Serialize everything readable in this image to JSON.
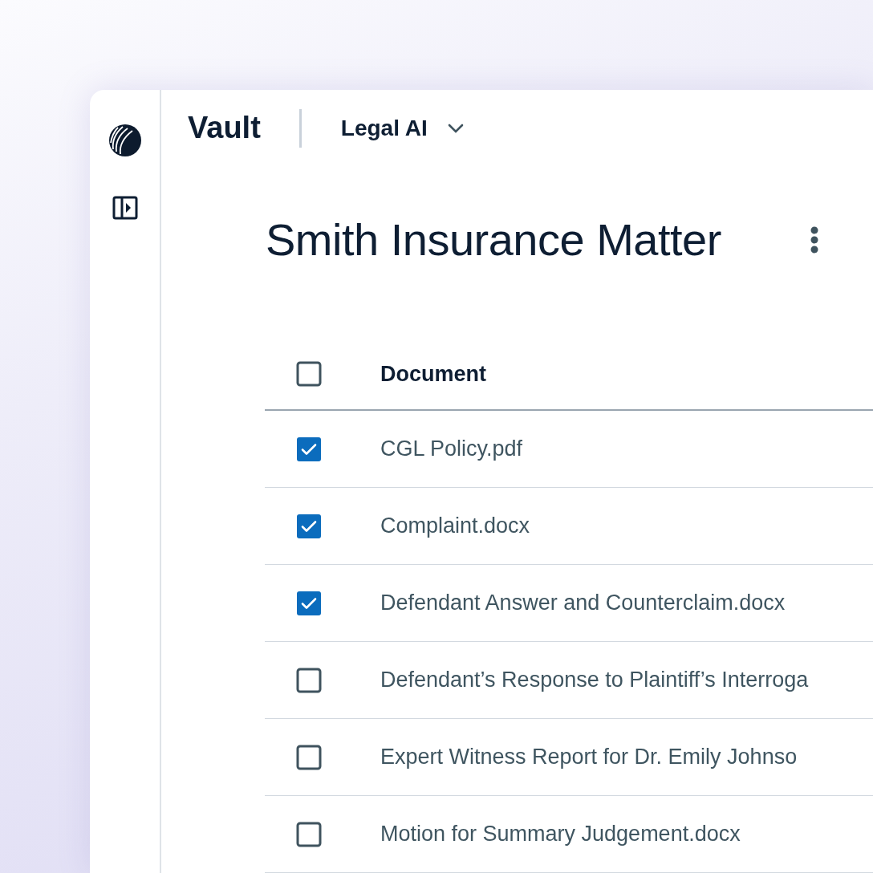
{
  "header": {
    "app_name": "Vault",
    "workspace": "Legal AI"
  },
  "title": "Smith Insurance Matter",
  "table": {
    "select_all_checked": false,
    "columns": [
      "Document"
    ],
    "rows": [
      {
        "name": "CGL Policy.pdf",
        "checked": true
      },
      {
        "name": "Complaint.docx",
        "checked": true
      },
      {
        "name": "Defendant Answer and Counterclaim.docx",
        "checked": true
      },
      {
        "name": "Defendant’s Response to Plaintiff’s Interroga",
        "checked": false
      },
      {
        "name": "Expert Witness Report for Dr. Emily Johnso",
        "checked": false
      },
      {
        "name": "Motion for Summary Judgement.docx",
        "checked": false
      }
    ]
  }
}
